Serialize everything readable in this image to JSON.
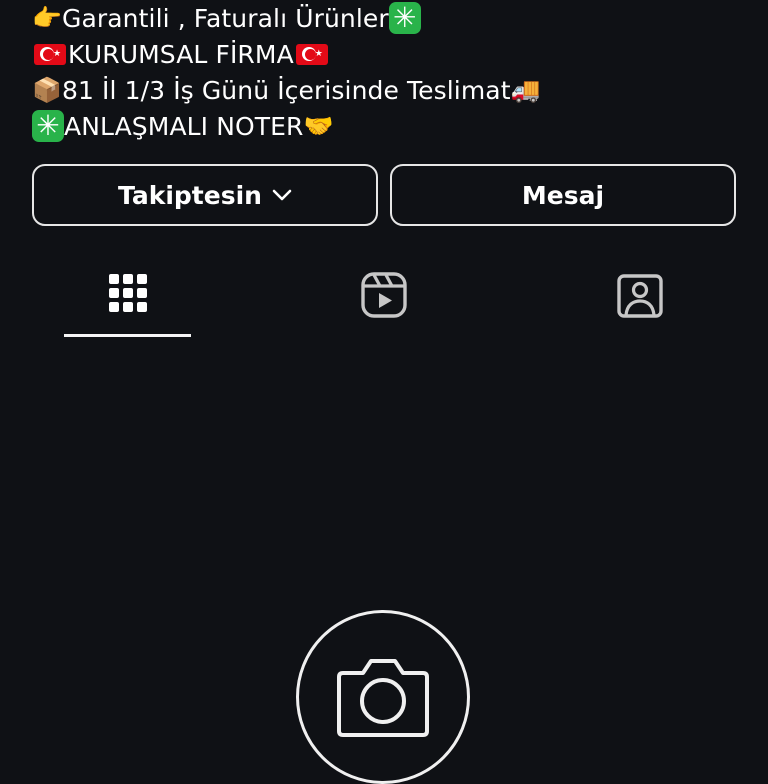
{
  "bio": {
    "line1": {
      "prefix_icon": "backhand-index-pointing-right-icon",
      "text": "Garantili , Faturalı Ürünler ",
      "suffix_icon": "eight-spoked-asterisk-icon"
    },
    "line2": {
      "prefix_icon": "turkey-flag-icon",
      "text": "KURUMSAL FİRMA",
      "suffix_icon": "turkey-flag-icon"
    },
    "line3": {
      "prefix_icon": "package-icon",
      "text": "81 İl 1/3 İş Günü İçerisinde Teslimat ",
      "suffix_icon": "delivery-truck-icon"
    },
    "line4": {
      "prefix_icon": "eight-spoked-asterisk-icon",
      "text": "ANLAŞMALI NOTER",
      "suffix_icon": "handshake-icon"
    }
  },
  "actions": {
    "follow_label": "Takiptesin",
    "message_label": "Mesaj"
  },
  "tabs": [
    {
      "icon": "grid-icon",
      "selected": true
    },
    {
      "icon": "reels-icon",
      "selected": false
    },
    {
      "icon": "tagged-icon",
      "selected": false
    }
  ],
  "empty_state": {
    "icon": "camera-icon"
  },
  "colors": {
    "background": "#0f1115",
    "text": "#ffffff",
    "border": "#e6e6e6",
    "green_emoji": "#29b34a",
    "flag_red": "#e30a17",
    "inactive_icon": "#c7c7c7"
  }
}
